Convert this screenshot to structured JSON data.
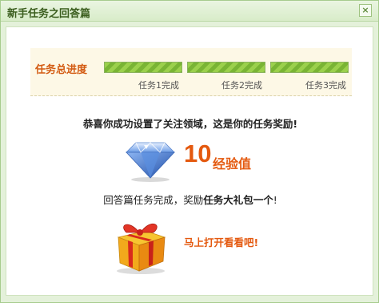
{
  "dialog": {
    "title": "新手任务之回答篇",
    "close_label": "×"
  },
  "progress": {
    "label": "任务总进度",
    "steps": [
      {
        "label": "任务1完成",
        "complete": true
      },
      {
        "label": "任务2完成",
        "complete": true
      },
      {
        "label": "任务3完成",
        "complete": true
      }
    ],
    "bar_color": "#9bd04c"
  },
  "reward": {
    "congrats": "恭喜你成功设置了关注领域，这是你的任务奖励!",
    "points_value": "10",
    "points_unit": "经验值",
    "points_color": "#e4590f",
    "line_prefix": "回答篇任务完成，奖励",
    "line_bold": "任务大礼包一个",
    "line_suffix": "!",
    "icons": [
      "diamond-icon",
      "gift-icon"
    ]
  },
  "action": {
    "open_label": "马上打开看看吧!"
  }
}
